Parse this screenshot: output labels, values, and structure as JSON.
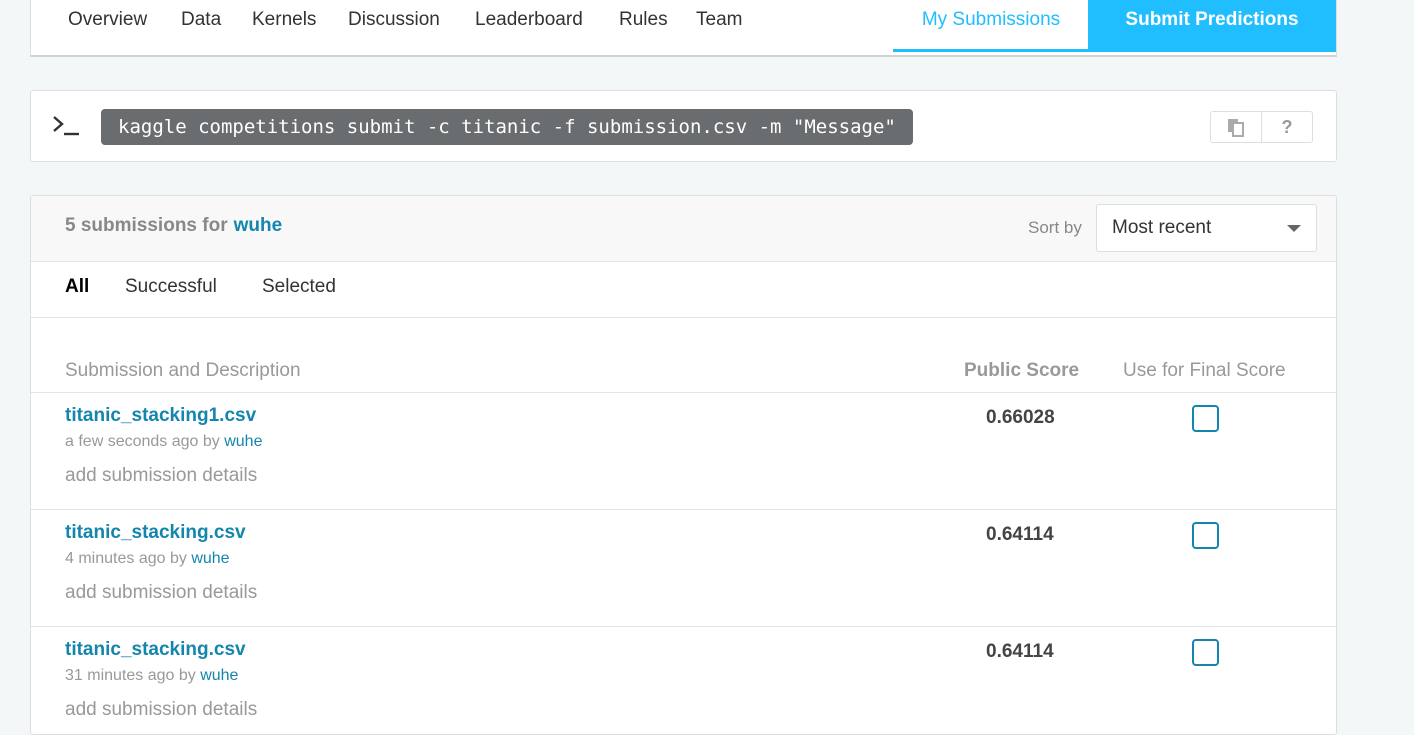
{
  "nav": {
    "tabs": [
      "Overview",
      "Data",
      "Kernels",
      "Discussion",
      "Leaderboard",
      "Rules",
      "Team"
    ],
    "my_submissions": "My Submissions",
    "submit_predictions": "Submit Predictions"
  },
  "cli": {
    "command": "kaggle competitions submit -c titanic -f submission.csv -m \"Message\"",
    "help_label": "?"
  },
  "panel": {
    "count_text": "5 submissions for",
    "user": "wuhe",
    "sort_label": "Sort by",
    "sort_value": "Most recent",
    "filters": [
      "All",
      "Successful",
      "Selected"
    ],
    "columns": {
      "submission": "Submission and Description",
      "score": "Public Score",
      "final": "Use for Final Score"
    },
    "rows": [
      {
        "file": "titanic_stacking1.csv",
        "time": "a few seconds ago by",
        "user": "wuhe",
        "details": "add submission details",
        "score": "0.66028"
      },
      {
        "file": "titanic_stacking.csv",
        "time": "4 minutes ago by",
        "user": "wuhe",
        "details": "add submission details",
        "score": "0.64114"
      },
      {
        "file": "titanic_stacking.csv",
        "time": "31 minutes ago by",
        "user": "wuhe",
        "details": "add submission details",
        "score": "0.64114"
      }
    ]
  },
  "colors": {
    "accent": "#20beff",
    "link": "#1486ad"
  }
}
